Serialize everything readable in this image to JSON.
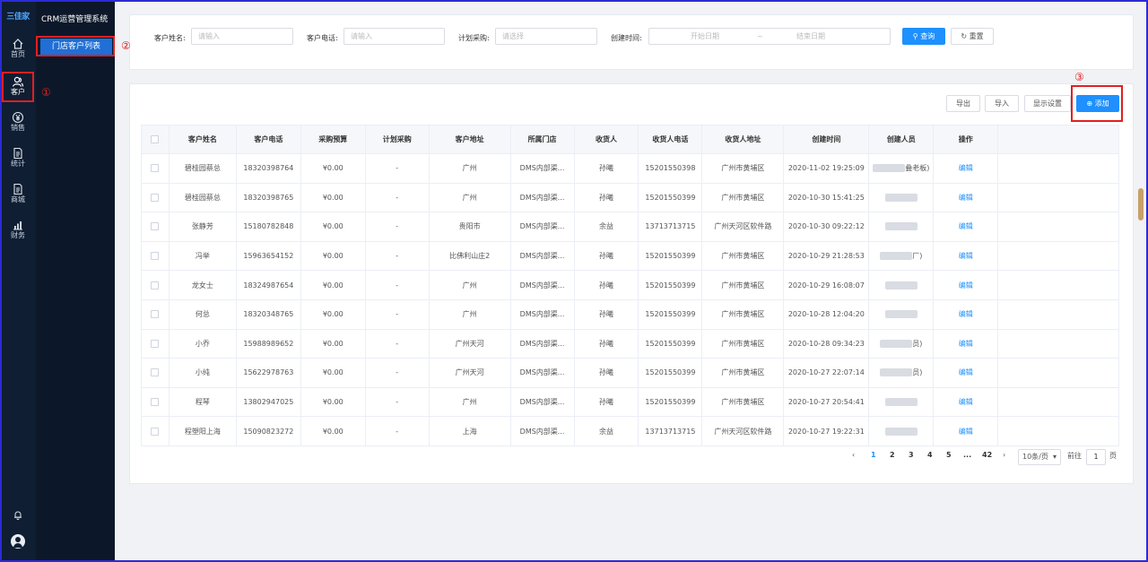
{
  "app": {
    "logo_text": "三佳家",
    "system_title": "CRM运营管理系统"
  },
  "rail": [
    {
      "label": "首页",
      "icon": "home-icon"
    },
    {
      "label": "客户",
      "icon": "customer-icon"
    },
    {
      "label": "销售",
      "icon": "yen-icon"
    },
    {
      "label": "统计",
      "icon": "document-icon"
    },
    {
      "label": "商城",
      "icon": "document-icon"
    },
    {
      "label": "财务",
      "icon": "bar-chart-icon"
    }
  ],
  "submenu": {
    "active_item": "门店客户列表"
  },
  "annotations": [
    "①",
    "②",
    "③"
  ],
  "filters": {
    "name_label": "客户姓名:",
    "name_placeholder": "请输入",
    "phone_label": "客户电话:",
    "phone_placeholder": "请输入",
    "plan_label": "计划采购:",
    "plan_placeholder": "请选择",
    "created_label": "创建时间:",
    "start_placeholder": "开始日期",
    "range_sep": "~",
    "end_placeholder": "结束日期",
    "query_label": "查询",
    "reset_label": "重置"
  },
  "toolbar": {
    "export": "导出",
    "import": "导入",
    "display_settings": "显示设置",
    "add": "添加"
  },
  "table": {
    "columns": [
      "客户姓名",
      "客户电话",
      "采购预算",
      "计划采购",
      "客户地址",
      "所属门店",
      "收货人",
      "收货人电话",
      "收货人地址",
      "创建时间",
      "创建人员",
      "操作"
    ],
    "rows": [
      {
        "name": "碧桂园蔡总",
        "phone": "18320398764",
        "budget": "¥0.00",
        "plan": "-",
        "address": "广州",
        "store": "DMS内部渠...",
        "receiver": "孙曦",
        "receiver_phone": "15201550398",
        "receiver_address": "广州市黄埔区",
        "created": "2020-11-02 19:25:09",
        "creator": "叠老板)",
        "action": "编辑"
      },
      {
        "name": "碧桂园蔡总",
        "phone": "18320398765",
        "budget": "¥0.00",
        "plan": "-",
        "address": "广州",
        "store": "DMS内部渠...",
        "receiver": "孙曦",
        "receiver_phone": "15201550399",
        "receiver_address": "广州市黄埔区",
        "created": "2020-10-30 15:41:25",
        "creator": "",
        "action": "编辑"
      },
      {
        "name": "张静芳",
        "phone": "15180782848",
        "budget": "¥0.00",
        "plan": "-",
        "address": "贵阳市",
        "store": "DMS内部渠...",
        "receiver": "余益",
        "receiver_phone": "13713713715",
        "receiver_address": "广州天河区软件路",
        "created": "2020-10-30 09:22:12",
        "creator": "",
        "action": "编辑"
      },
      {
        "name": "冯举",
        "phone": "15963654152",
        "budget": "¥0.00",
        "plan": "-",
        "address": "比佛利山庄2",
        "store": "DMS内部渠...",
        "receiver": "孙曦",
        "receiver_phone": "15201550399",
        "receiver_address": "广州市黄埔区",
        "created": "2020-10-29 21:28:53",
        "creator": "厂)",
        "action": "编辑"
      },
      {
        "name": "龙女士",
        "phone": "18324987654",
        "budget": "¥0.00",
        "plan": "-",
        "address": "广州",
        "store": "DMS内部渠...",
        "receiver": "孙曦",
        "receiver_phone": "15201550399",
        "receiver_address": "广州市黄埔区",
        "created": "2020-10-29 16:08:07",
        "creator": "",
        "action": "编辑"
      },
      {
        "name": "何总",
        "phone": "18320348765",
        "budget": "¥0.00",
        "plan": "-",
        "address": "广州",
        "store": "DMS内部渠...",
        "receiver": "孙曦",
        "receiver_phone": "15201550399",
        "receiver_address": "广州市黄埔区",
        "created": "2020-10-28 12:04:20",
        "creator": "",
        "action": "编辑"
      },
      {
        "name": "小乔",
        "phone": "15988989652",
        "budget": "¥0.00",
        "plan": "-",
        "address": "广州天河",
        "store": "DMS内部渠...",
        "receiver": "孙曦",
        "receiver_phone": "15201550399",
        "receiver_address": "广州市黄埔区",
        "created": "2020-10-28 09:34:23",
        "creator": "员)",
        "action": "编辑"
      },
      {
        "name": "小纯",
        "phone": "15622978763",
        "budget": "¥0.00",
        "plan": "-",
        "address": "广州天河",
        "store": "DMS内部渠...",
        "receiver": "孙曦",
        "receiver_phone": "15201550399",
        "receiver_address": "广州市黄埔区",
        "created": "2020-10-27 22:07:14",
        "creator": "员)",
        "action": "编辑"
      },
      {
        "name": "程琴",
        "phone": "13802947025",
        "budget": "¥0.00",
        "plan": "-",
        "address": "广州",
        "store": "DMS内部渠...",
        "receiver": "孙曦",
        "receiver_phone": "15201550399",
        "receiver_address": "广州市黄埔区",
        "created": "2020-10-27 20:54:41",
        "creator": "",
        "action": "编辑"
      },
      {
        "name": "程塑阳上海",
        "phone": "15090823272",
        "budget": "¥0.00",
        "plan": "-",
        "address": "上海",
        "store": "DMS内部渠...",
        "receiver": "余益",
        "receiver_phone": "13713713715",
        "receiver_address": "广州天河区软件路",
        "created": "2020-10-27 19:22:31",
        "creator": "",
        "action": "编辑"
      }
    ]
  },
  "pagination": {
    "pages": [
      "1",
      "2",
      "3",
      "4",
      "5",
      "...",
      "42"
    ],
    "current": "1",
    "page_size": "10条/页",
    "goto_label": "前往",
    "goto_value": "1",
    "page_unit": "页"
  }
}
